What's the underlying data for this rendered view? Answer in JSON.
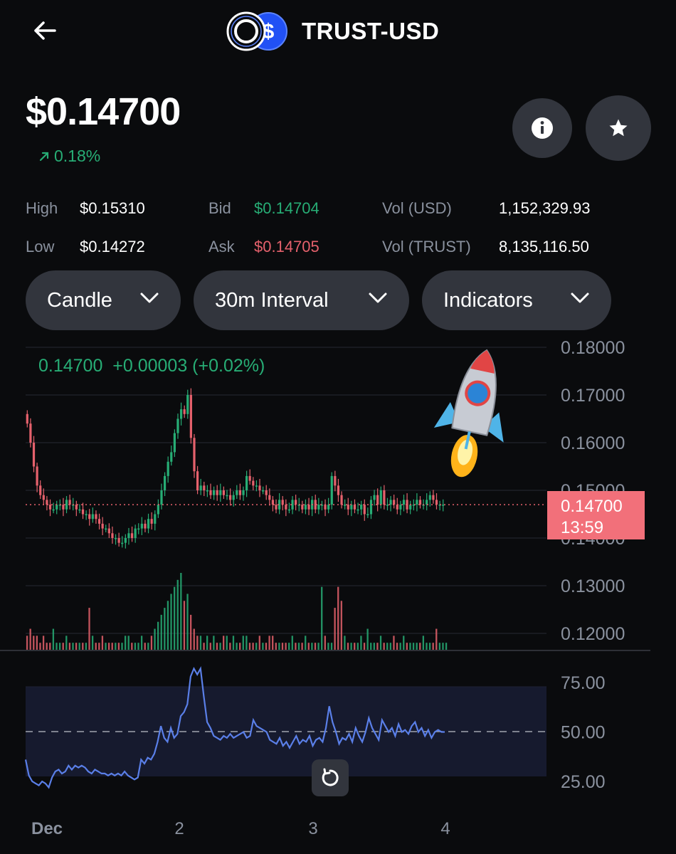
{
  "header": {
    "title": "TRUST-USD",
    "back_icon": "arrow-left-icon",
    "logo_icon": "coin-pair-icon"
  },
  "price": {
    "value": "$0.14700",
    "change": "0.18%",
    "change_icon": "arrow-up-right-icon"
  },
  "actions": {
    "info_icon": "info-icon",
    "star_icon": "star-icon"
  },
  "stats": {
    "high_label": "High",
    "high_value": "$0.15310",
    "low_label": "Low",
    "low_value": "$0.14272",
    "bid_label": "Bid",
    "bid_value": "$0.14704",
    "ask_label": "Ask",
    "ask_value": "$0.14705",
    "vol_usd_label": "Vol (USD)",
    "vol_usd_value": "1,152,329.93",
    "vol_trust_label": "Vol (TRUST)",
    "vol_trust_value": "8,135,116.50"
  },
  "controls": {
    "chart_type": "Candle",
    "interval": "30m Interval",
    "indicators": "Indicators"
  },
  "colors": {
    "up": "#27ad75",
    "down": "#e5616c",
    "rsi_line": "#5a7fe8",
    "background": "#0a0b0d",
    "pill": "#32353d"
  },
  "chart_data": {
    "type": "candlestick",
    "legend_text": "0.14700  +0.00003 (+0.02%)",
    "y_ticks": [
      "0.18000",
      "0.17000",
      "0.16000",
      "0.15000",
      "0.14000",
      "0.13000",
      "0.12000"
    ],
    "ylim": [
      0.12,
      0.18
    ],
    "current_price_label": "0.14700",
    "countdown_label": "13:59",
    "current_price": 0.147,
    "x_ticks": [
      "Dec",
      "2",
      "3",
      "4"
    ],
    "close_series": [
      0.164,
      0.16,
      0.155,
      0.151,
      0.149,
      0.148,
      0.147,
      0.146,
      0.146,
      0.147,
      0.147,
      0.146,
      0.148,
      0.147,
      0.147,
      0.146,
      0.146,
      0.145,
      0.145,
      0.144,
      0.145,
      0.144,
      0.143,
      0.142,
      0.142,
      0.141,
      0.14,
      0.14,
      0.139,
      0.139,
      0.14,
      0.141,
      0.14,
      0.142,
      0.142,
      0.143,
      0.142,
      0.144,
      0.143,
      0.145,
      0.147,
      0.15,
      0.153,
      0.156,
      0.158,
      0.162,
      0.165,
      0.167,
      0.166,
      0.17,
      0.161,
      0.154,
      0.15,
      0.151,
      0.15,
      0.15,
      0.149,
      0.15,
      0.149,
      0.15,
      0.149,
      0.149,
      0.148,
      0.149,
      0.15,
      0.149,
      0.15,
      0.153,
      0.152,
      0.151,
      0.151,
      0.15,
      0.15,
      0.149,
      0.148,
      0.147,
      0.146,
      0.148,
      0.147,
      0.146,
      0.146,
      0.148,
      0.147,
      0.147,
      0.146,
      0.147,
      0.146,
      0.148,
      0.146,
      0.147,
      0.147,
      0.146,
      0.147,
      0.153,
      0.151,
      0.149,
      0.147,
      0.147,
      0.146,
      0.147,
      0.146,
      0.146,
      0.147,
      0.145,
      0.145,
      0.148,
      0.149,
      0.147,
      0.15,
      0.147,
      0.147,
      0.148,
      0.147,
      0.146,
      0.147,
      0.148,
      0.146,
      0.147,
      0.147,
      0.148,
      0.147,
      0.147,
      0.148,
      0.149,
      0.148,
      0.147,
      0.147,
      0.147
    ],
    "volume_series": [
      2,
      3,
      2,
      2,
      1,
      2,
      1,
      1,
      3,
      1,
      1,
      1,
      2,
      1,
      1,
      1,
      1,
      1,
      1,
      6,
      2,
      1,
      1,
      2,
      1,
      1,
      1,
      1,
      1,
      1,
      2,
      2,
      1,
      1,
      1,
      2,
      1,
      1,
      2,
      3,
      4,
      5,
      6,
      7,
      8,
      9,
      10,
      11,
      7,
      8,
      5,
      3,
      2,
      2,
      1,
      2,
      1,
      2,
      1,
      1,
      2,
      2,
      1,
      2,
      1,
      1,
      2,
      2,
      1,
      1,
      1,
      2,
      1,
      1,
      2,
      2,
      1,
      1,
      1,
      1,
      1,
      2,
      1,
      1,
      1,
      2,
      1,
      1,
      1,
      1,
      9,
      2,
      1,
      1,
      6,
      9,
      7,
      2,
      1,
      1,
      1,
      1,
      2,
      1,
      3,
      1,
      1,
      1,
      2,
      1,
      1,
      1,
      2,
      1,
      1,
      2,
      1,
      1,
      1,
      1,
      1,
      2,
      1,
      1,
      1,
      3,
      1,
      1,
      1
    ]
  },
  "rsi_data": {
    "type": "line",
    "y_ticks": [
      "75.00",
      "50.00",
      "25.00"
    ],
    "ylim": [
      20,
      80
    ],
    "band": [
      30,
      70
    ],
    "midline": 50,
    "values": [
      36,
      28,
      25,
      24,
      23,
      25,
      24,
      22,
      27,
      30,
      31,
      29,
      30,
      33,
      31,
      33,
      32,
      33,
      32,
      30,
      29,
      31,
      30,
      29,
      29,
      28,
      29,
      28,
      29,
      28,
      30,
      28,
      27,
      26,
      27,
      36,
      34,
      37,
      36,
      39,
      45,
      53,
      47,
      45,
      52,
      47,
      49,
      58,
      60,
      64,
      78,
      82,
      79,
      82,
      68,
      55,
      52,
      48,
      47,
      46,
      48,
      47,
      49,
      47,
      48,
      49,
      50,
      47,
      48,
      56,
      53,
      52,
      51,
      50,
      46,
      45,
      44,
      47,
      43,
      45,
      42,
      45,
      48,
      44,
      46,
      45,
      48,
      43,
      46,
      47,
      45,
      52,
      63,
      55,
      50,
      44,
      47,
      46,
      49,
      45,
      52,
      48,
      45,
      50,
      57,
      52,
      49,
      46,
      56,
      53,
      50,
      52,
      48,
      54,
      50,
      51,
      49,
      53,
      55,
      50,
      52,
      48,
      51,
      47,
      50,
      51,
      50,
      50
    ]
  },
  "reset_icon": "reset-icon",
  "rocket_icon": "rocket-icon"
}
